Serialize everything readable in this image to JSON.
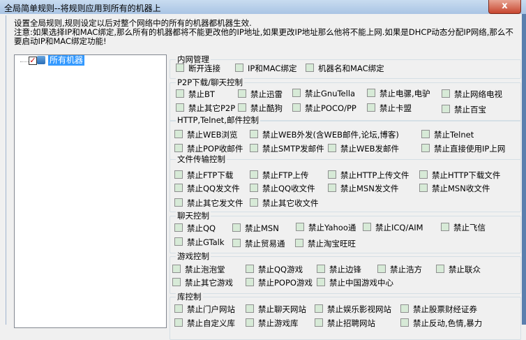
{
  "window": {
    "title": "全局简单规则--将规则应用到所有的机器上",
    "close": "x"
  },
  "description": {
    "line1": "设置全局规则,规则设定以后对整个网络中的所有的机器都机器生效.",
    "line2": "注意:如果选择IP和MAC绑定,那么所有的机器都将不能更改他的IP地址,如果更改IP地址那么他将不能上网.如果是DHCP动态分配IP网络,那么不要启动IP和MAC绑定功能!"
  },
  "tree": {
    "root_label": "所有机器",
    "root_checked": true
  },
  "groups": [
    {
      "title": "内网管理",
      "items": [
        "断开连接",
        "IP和MAC绑定",
        "机器名和MAC绑定"
      ]
    },
    {
      "title": "P2P下载/聊天控制",
      "items": [
        "禁止BT",
        "禁止迅雷",
        "禁止GnuTella",
        "禁止电骡,电驴",
        "禁止网络电视",
        "禁止其它P2P",
        "禁止酷狗",
        "禁止POCO/PP",
        "禁止卡盟",
        "禁止百宝"
      ]
    },
    {
      "title": "HTTP,Telnet,邮件控制",
      "items": [
        "禁止WEB浏览",
        "禁止WEB外发(含WEB邮件,论坛,博客)",
        "禁止Telnet",
        "禁止POP收邮件",
        "禁止SMTP发邮件",
        "禁止WEB发邮件",
        "禁止直接使用IP上网"
      ]
    },
    {
      "title": "文件传输控制",
      "items": [
        "禁止FTP下载",
        "禁止FTP上传",
        "禁止HTTP上传文件",
        "禁止HTTP下载文件",
        "禁止QQ发文件",
        "禁止QQ收文件",
        "禁止MSN发文件",
        "禁止MSN收文件",
        "禁止其它发文件",
        "禁止其它收文件"
      ]
    },
    {
      "title": "聊天控制",
      "items": [
        "禁止QQ",
        "禁止MSN",
        "禁止Yahoo通",
        "禁止ICQ/AIM",
        "禁止飞信",
        "禁止GTalk",
        "禁止贸易通",
        "禁止淘宝旺旺"
      ]
    },
    {
      "title": "游戏控制",
      "items": [
        "禁止泡泡堂",
        "禁止QQ游戏",
        "禁止边锋",
        "禁止浩方",
        "禁止联众",
        "禁止其它游戏",
        "禁止POPO游戏",
        "禁止中国游戏中心"
      ]
    },
    {
      "title": "库控制",
      "items": [
        "禁止门户网站",
        "禁止聊天网站",
        "禁止娱乐影视网站",
        "禁止股票财经证券",
        "禁止自定义库",
        "禁止游戏库",
        "禁止招聘网站",
        "禁止反动,色情,暴力"
      ]
    }
  ]
}
